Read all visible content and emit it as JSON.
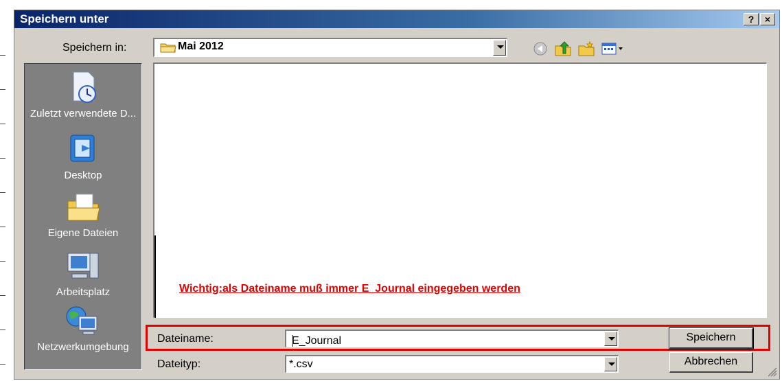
{
  "window": {
    "title": "Speichern unter",
    "help_label": "?",
    "close_label": "×"
  },
  "toolbar": {
    "save_in_label": "Speichern in:",
    "location": "Mai 2012",
    "icons": [
      "back-icon",
      "up-folder-icon",
      "new-folder-icon",
      "view-menu-icon"
    ]
  },
  "places": [
    {
      "name": "recent-documents",
      "label": "Zuletzt verwendete D..."
    },
    {
      "name": "desktop",
      "label": "Desktop"
    },
    {
      "name": "my-documents",
      "label": "Eigene Dateien"
    },
    {
      "name": "my-computer",
      "label": "Arbeitsplatz"
    },
    {
      "name": "network",
      "label": "Netzwerkumgebung"
    }
  ],
  "note": {
    "text": "Wichtig:als Dateiname muß immer E_Journal eingegeben werden",
    "color": "#e00000"
  },
  "filename": {
    "label": "Dateiname:",
    "value": "E_Journal"
  },
  "filetype": {
    "label": "Dateityp:",
    "value": "*.csv"
  },
  "buttons": {
    "save": "Speichern",
    "cancel": "Abbrechen"
  },
  "colors": {
    "title_start": "#0a246a",
    "title_end": "#a6caf0",
    "face": "#d4d0c8",
    "highlight": "#e00000"
  }
}
